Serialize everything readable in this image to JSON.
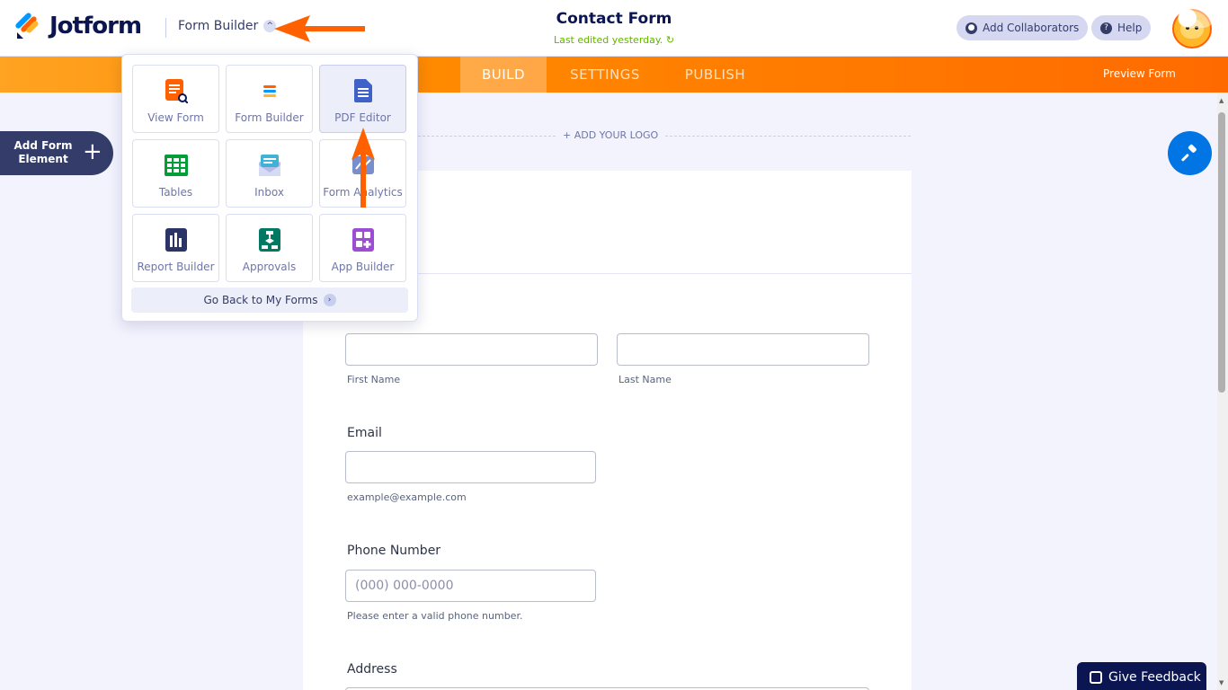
{
  "header": {
    "brand": "Jotform",
    "switcher_label": "Form Builder",
    "form_title": "Contact Form",
    "last_edited": "Last edited yesterday.",
    "add_collaborators": "Add Collaborators",
    "help": "Help"
  },
  "nav": {
    "tabs": [
      {
        "label": "BUILD",
        "active": true
      },
      {
        "label": "SETTINGS",
        "active": false
      },
      {
        "label": "PUBLISH",
        "active": false
      }
    ],
    "preview_label": "Preview Form"
  },
  "sidebar": {
    "add_element_label": "Add Form Element"
  },
  "dropdown": {
    "tiles": [
      {
        "label": "View Form",
        "icon": "view-form-icon"
      },
      {
        "label": "Form Builder",
        "icon": "form-builder-icon"
      },
      {
        "label": "PDF Editor",
        "icon": "pdf-editor-icon",
        "selected": true
      },
      {
        "label": "Tables",
        "icon": "tables-icon"
      },
      {
        "label": "Inbox",
        "icon": "inbox-icon"
      },
      {
        "label": "Form Analytics",
        "icon": "analytics-icon"
      },
      {
        "label": "Report Builder",
        "icon": "report-builder-icon"
      },
      {
        "label": "Approvals",
        "icon": "approvals-icon"
      },
      {
        "label": "App Builder",
        "icon": "app-builder-icon"
      }
    ],
    "go_back": "Go Back to My Forms"
  },
  "form": {
    "add_logo": "+ ADD YOUR LOGO",
    "first_name_sub": "First Name",
    "last_name_sub": "Last Name",
    "email_label": "Email",
    "email_sub": "example@example.com",
    "phone_label": "Phone Number",
    "phone_placeholder": "(000) 000-0000",
    "phone_sub": "Please enter a valid phone number.",
    "address_label": "Address"
  },
  "feedback": {
    "label": "Give Feedback"
  },
  "colors": {
    "accent_orange": "#ff6100",
    "navy": "#0a1551",
    "blue": "#0075e3",
    "green": "#64b200"
  }
}
